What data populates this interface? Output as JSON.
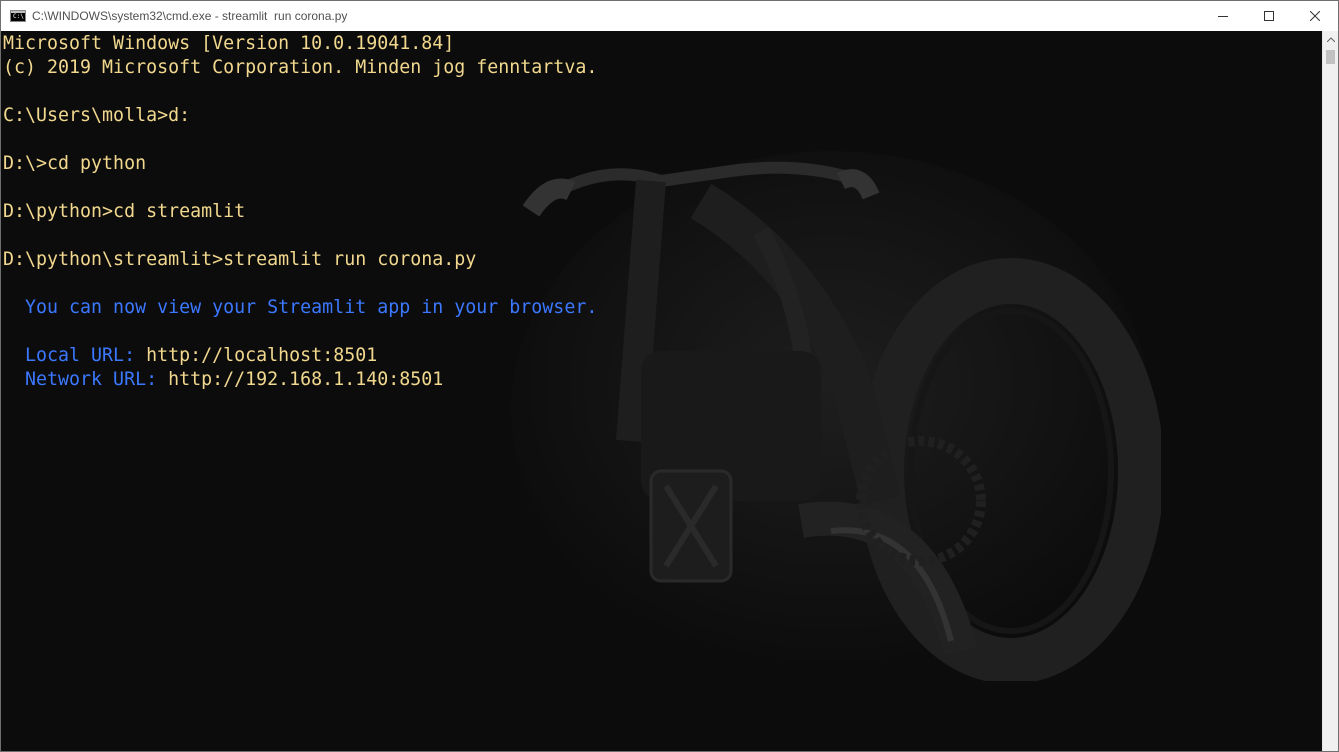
{
  "window": {
    "title": "C:\\WINDOWS\\system32\\cmd.exe - streamlit  run corona.py",
    "icon": "cmd-icon",
    "icon_text": "C:\\"
  },
  "caption": {
    "minimize_icon": "minimize-icon",
    "maximize_icon": "maximize-icon",
    "close_icon": "close-icon"
  },
  "console": {
    "lines": [
      "Microsoft Windows [Version 10.0.19041.84]",
      "(c) 2019 Microsoft Corporation. Minden jog fenntartva.",
      "",
      "C:\\Users\\molla>d:",
      "",
      "D:\\>cd python",
      "",
      "D:\\python>cd streamlit",
      "",
      "D:\\python\\streamlit>streamlit run corona.py",
      "",
      "  You can now view your Streamlit app in your browser.",
      "",
      "  Local URL: ",
      "  Network URL: "
    ],
    "local_url": "http://localhost:8501",
    "network_url": "http://192.168.1.140:8501"
  },
  "colors": {
    "foreground": "#f1d88e",
    "info": "#3b78ff",
    "background": "#0c0c0c"
  }
}
